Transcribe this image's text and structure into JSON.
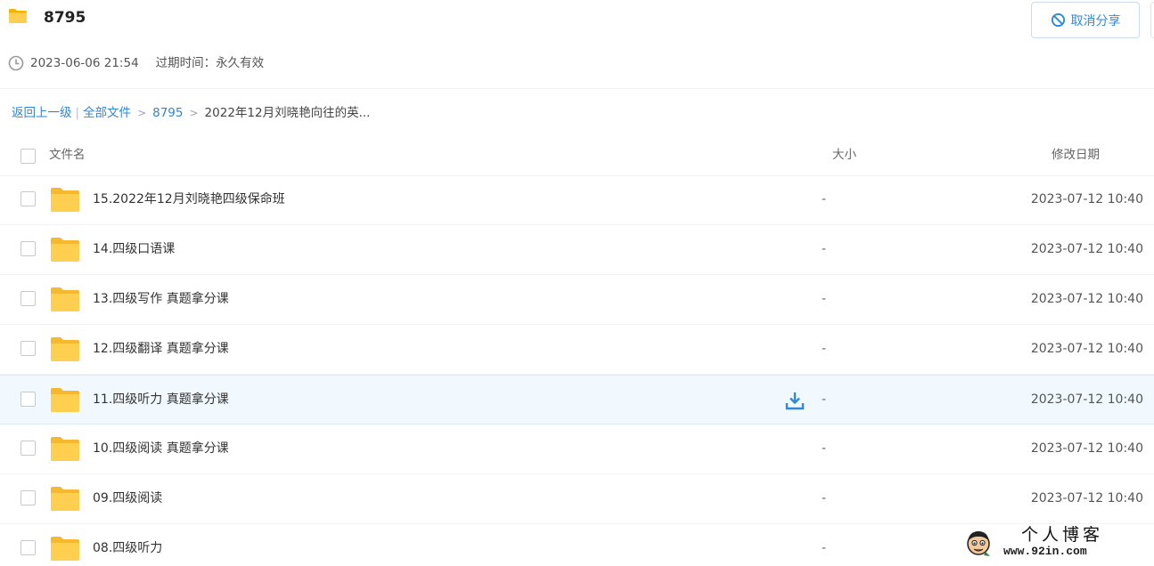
{
  "share": {
    "title": "8795",
    "created": "2023-06-06 21:54",
    "expire": "过期时间：永久有效",
    "cancel_label": "取消分享"
  },
  "breadcrumb": {
    "back": "返回上一级",
    "separator": "|",
    "items": [
      "全部文件",
      "8795"
    ],
    "arrow": ">",
    "current": "2022年12月刘晓艳向往的英..."
  },
  "table": {
    "columns": {
      "name": "文件名",
      "size": "大小",
      "modified": "修改日期"
    },
    "rows": [
      {
        "name": "15.2022年12月刘晓艳四级保命班",
        "size": "-",
        "modified": "2023-07-12 10:40"
      },
      {
        "name": "14.四级口语课",
        "size": "-",
        "modified": "2023-07-12 10:40"
      },
      {
        "name": "13.四级写作 真题拿分课",
        "size": "-",
        "modified": "2023-07-12 10:40"
      },
      {
        "name": "12.四级翻译 真题拿分课",
        "size": "-",
        "modified": "2023-07-12 10:40"
      },
      {
        "name": "11.四级听力 真题拿分课",
        "size": "-",
        "modified": "2023-07-12 10:40"
      },
      {
        "name": "10.四级阅读 真题拿分课",
        "size": "-",
        "modified": "2023-07-12 10:40"
      },
      {
        "name": "09.四级阅读",
        "size": "-",
        "modified": "2023-07-12 10:40"
      },
      {
        "name": "08.四级听力",
        "size": "-",
        "modified": ""
      }
    ]
  },
  "watermark": {
    "title": "个人博客",
    "url": "www.92in.com"
  },
  "colors": {
    "accent": "#2e8ad8",
    "folder": "#ffd04f",
    "hover_row": "#f1f9fe"
  },
  "icons": [
    "folder-icon",
    "ban-icon",
    "clock-icon",
    "download-icon",
    "checkbox"
  ]
}
